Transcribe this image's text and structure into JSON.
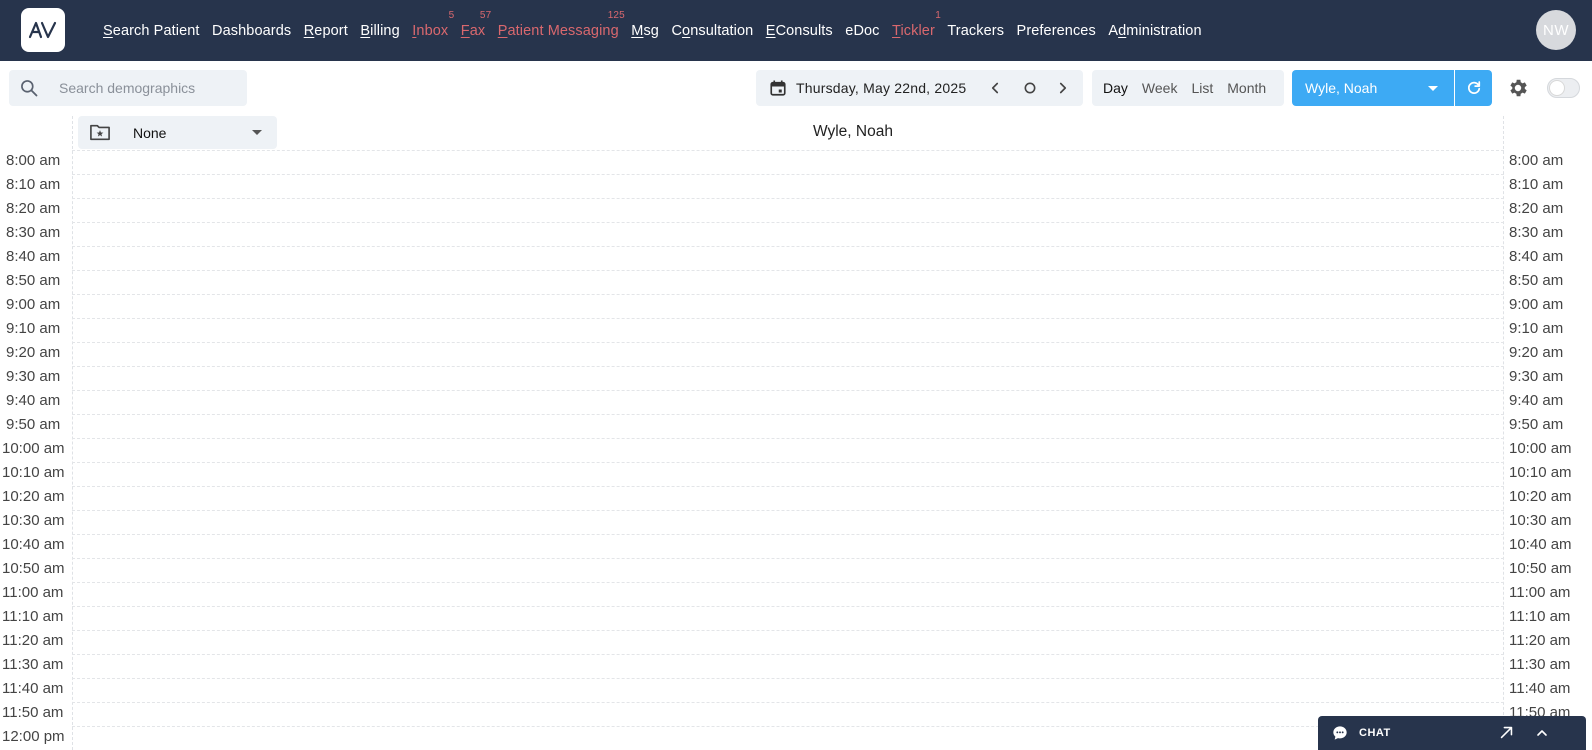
{
  "app": {
    "logo_text": "AV",
    "user_initials": "NW"
  },
  "nav": {
    "items": [
      {
        "pre": "",
        "u": "S",
        "post": "earch Patient",
        "badge": "",
        "alert": false
      },
      {
        "pre": "Dashboards",
        "u": "",
        "post": "",
        "badge": "",
        "alert": false
      },
      {
        "pre": "",
        "u": "R",
        "post": "eport",
        "badge": "",
        "alert": false
      },
      {
        "pre": "",
        "u": "B",
        "post": "illing",
        "badge": "",
        "alert": false
      },
      {
        "pre": "",
        "u": "I",
        "post": "nbox",
        "badge": "5",
        "alert": true
      },
      {
        "pre": "",
        "u": "F",
        "post": "ax",
        "badge": "57",
        "alert": true
      },
      {
        "pre": "",
        "u": "P",
        "post": "atient Messaging",
        "badge": "125",
        "alert": true
      },
      {
        "pre": "",
        "u": "M",
        "post": "sg",
        "badge": "",
        "alert": false
      },
      {
        "pre": "C",
        "u": "o",
        "post": "nsultation",
        "badge": "",
        "alert": false
      },
      {
        "pre": "",
        "u": "E",
        "post": "Consults",
        "badge": "",
        "alert": false
      },
      {
        "pre": "eDoc",
        "u": "",
        "post": "",
        "badge": "",
        "alert": false
      },
      {
        "pre": "",
        "u": "T",
        "post": "ickler",
        "badge": "1",
        "alert": true
      },
      {
        "pre": "Trackers",
        "u": "",
        "post": "",
        "badge": "",
        "alert": false
      },
      {
        "pre": "Preferences",
        "u": "",
        "post": "",
        "badge": "",
        "alert": false
      },
      {
        "pre": "A",
        "u": "d",
        "post": "ministration",
        "badge": "",
        "alert": false
      }
    ]
  },
  "toolbar": {
    "search_placeholder": "Search demographics",
    "date": "Thursday, May 22nd, 2025",
    "views": [
      "Day",
      "Week",
      "List",
      "Month"
    ],
    "active_view": "Day",
    "provider": "Wyle, Noah"
  },
  "schedule": {
    "column_selector": "None",
    "column_header": "Wyle, Noah",
    "times": [
      "8:00 am",
      "8:10 am",
      "8:20 am",
      "8:30 am",
      "8:40 am",
      "8:50 am",
      "9:00 am",
      "9:10 am",
      "9:20 am",
      "9:30 am",
      "9:40 am",
      "9:50 am",
      "10:00 am",
      "10:10 am",
      "10:20 am",
      "10:30 am",
      "10:40 am",
      "10:50 am",
      "11:00 am",
      "11:10 am",
      "11:20 am",
      "11:30 am",
      "11:40 am",
      "11:50 am",
      "12:00 pm"
    ]
  },
  "chat": {
    "title": "CHAT"
  },
  "colors": {
    "nav_bg": "#27344c",
    "alert": "#d9686e",
    "accent": "#3daaf4",
    "toolbar_bg": "#eef2f6"
  }
}
